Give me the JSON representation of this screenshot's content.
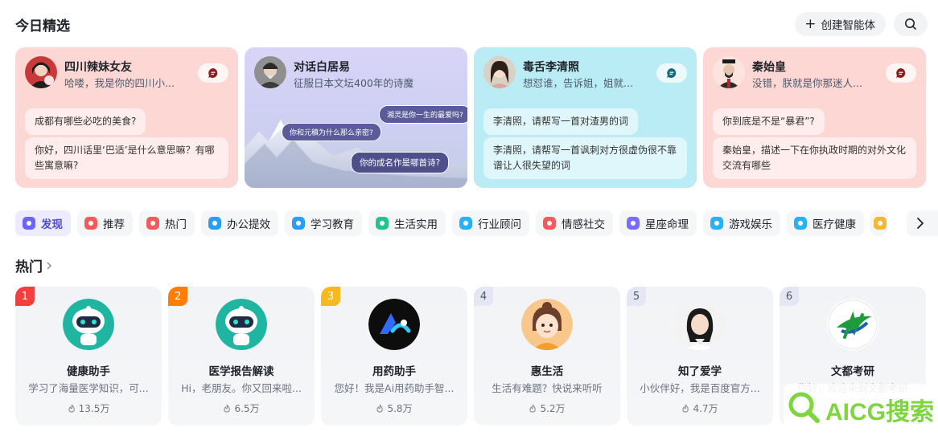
{
  "header": {
    "title": "今日精选",
    "create_label": "创建智能体",
    "search_icon": "search-icon"
  },
  "featured": [
    {
      "name": "四川辣妹女友",
      "desc": "哈喽，我是你的四川小...",
      "q1": "成都有哪些必吃的美食?",
      "q2": "你好，四川话里‘巴适’是什么意思嘛？有哪些寓意嘛?"
    },
    {
      "name": "对话白居易",
      "desc": "征服日本文坛400年的诗魔",
      "b1": "湘灵是你一生的最爱吗?",
      "b2": "你和元稹为什么那么亲密?",
      "b3": "你的成名作是哪首诗?"
    },
    {
      "name": "毒舌李清照",
      "desc": "想怼谁，告诉姐，姐就...",
      "q1": "李清照，请帮写一首对渣男的词",
      "q2": "李清照，请帮写一首讽刺对方很虚伪很不靠谱让人很失望的词"
    },
    {
      "name": "秦始皇",
      "desc": "没错，朕就是你那迷人...",
      "q1": "你到底是不是“暴君”?",
      "q2": "秦始皇，描述一下在你执政时期的对外文化交流有哪些"
    }
  ],
  "categories": [
    {
      "label": "发现",
      "color": "#6c63ff"
    },
    {
      "label": "推荐",
      "color": "#f25b5b"
    },
    {
      "label": "热门",
      "color": "#f25b5b"
    },
    {
      "label": "办公提效",
      "color": "#2a9df4"
    },
    {
      "label": "学习教育",
      "color": "#2a9df4"
    },
    {
      "label": "生活实用",
      "color": "#22c38e"
    },
    {
      "label": "行业顾问",
      "color": "#2ab0f4"
    },
    {
      "label": "情感社交",
      "color": "#f25b5b"
    },
    {
      "label": "星座命理",
      "color": "#7b6cf6"
    },
    {
      "label": "游戏娱乐",
      "color": "#2ab0f4"
    },
    {
      "label": "医疗健康",
      "color": "#2ab0f4"
    }
  ],
  "hot": {
    "title": "热门",
    "items": [
      {
        "rank": "1",
        "name": "健康助手",
        "desc": "学习了海量医学知识，可...",
        "stat": "13.5万",
        "rank_color": "#f53f3f"
      },
      {
        "rank": "2",
        "name": "医学报告解读",
        "desc": "Hi，老朋友。你又回来啦...",
        "stat": "6.5万",
        "rank_color": "#ff7d00"
      },
      {
        "rank": "3",
        "name": "用药助手",
        "desc": "您好！我是Ai用药助手智...",
        "stat": "5.8万",
        "rank_color": "#f7ba1e"
      },
      {
        "rank": "4",
        "name": "惠生活",
        "desc": "生活有难题？快说来听听",
        "stat": "5.2万",
        "rank_color": ""
      },
      {
        "rank": "5",
        "name": "知了爱学",
        "desc": "小伙伴好，我是百度官方...",
        "stat": "4.7万",
        "rank_color": ""
      },
      {
        "rank": "6",
        "name": "文都考研",
        "desc": "你好，欢迎来到文都考研",
        "stat": "",
        "rank_color": ""
      }
    ]
  },
  "watermark": "AICG搜索"
}
